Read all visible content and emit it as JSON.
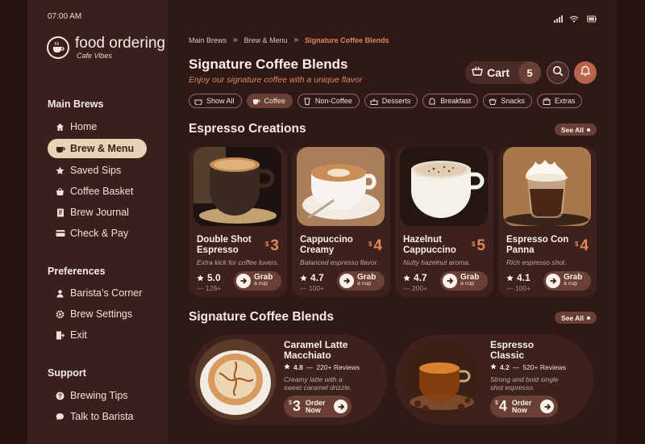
{
  "status": {
    "time": "07:00 AM"
  },
  "brand": {
    "title": "food ordering",
    "subtitle": "Cafe Vibes"
  },
  "sidebar": {
    "sections": [
      {
        "heading": "Main Brews",
        "items": [
          {
            "label": "Home",
            "icon": "home-icon"
          },
          {
            "label": "Brew & Menu",
            "icon": "coffee-cup-icon",
            "active": true
          },
          {
            "label": "Saved Sips",
            "icon": "star-icon"
          },
          {
            "label": "Coffee Basket",
            "icon": "basket-icon"
          },
          {
            "label": "Brew Journal",
            "icon": "journal-icon"
          },
          {
            "label": "Check & Pay",
            "icon": "card-icon"
          }
        ]
      },
      {
        "heading": "Preferences",
        "items": [
          {
            "label": "Barista’s Corner",
            "icon": "user-icon"
          },
          {
            "label": "Brew Settings",
            "icon": "gear-icon"
          },
          {
            "label": "Exit",
            "icon": "exit-icon"
          }
        ]
      },
      {
        "heading": "Support",
        "items": [
          {
            "label": "Brewing Tips",
            "icon": "help-icon"
          },
          {
            "label": "Talk to Barista",
            "icon": "chat-icon"
          }
        ]
      }
    ]
  },
  "breadcrumb": {
    "items": [
      "Main Brews",
      "Brew & Menu",
      "Signature Coffee Blends"
    ],
    "separator": "»"
  },
  "header": {
    "title": "Signature Coffee Blends",
    "subtitle": "Enjoy our signature coffee with a unique flavor",
    "cart_label": "Cart",
    "cart_count": "5"
  },
  "filters": [
    {
      "label": "Show All",
      "icon": "grid-icon"
    },
    {
      "label": "Coffee",
      "icon": "coffee-cup-icon",
      "active": true
    },
    {
      "label": "Non-Coffee",
      "icon": "cup-icon"
    },
    {
      "label": "Desserts",
      "icon": "cake-icon"
    },
    {
      "label": "Breakfast",
      "icon": "toast-icon"
    },
    {
      "label": "Snacks",
      "icon": "snack-icon"
    },
    {
      "label": "Extras",
      "icon": "extras-icon"
    }
  ],
  "espresso": {
    "title": "Espresso Creations",
    "see_all": "See All",
    "items": [
      {
        "name": "Double Shot Espresso",
        "currency": "$",
        "price": "3",
        "desc": "Extra kick for coffee lovers.",
        "rating": "5.0",
        "reviews": "128+",
        "grab": "Grab",
        "grab_sub": "a cup"
      },
      {
        "name": "Cappuccino Creamy",
        "currency": "$",
        "price": "4",
        "desc": "Balanced espresso flavor.",
        "rating": "4.7",
        "reviews": "100+",
        "grab": "Grab",
        "grab_sub": "a cup"
      },
      {
        "name": "Hazelnut Cappuccino",
        "currency": "$",
        "price": "5",
        "desc": "Nutty hazelnut aroma.",
        "rating": "4.7",
        "reviews": "200+",
        "grab": "Grab",
        "grab_sub": "a cup"
      },
      {
        "name": "Espresso Con Panna",
        "currency": "$",
        "price": "4",
        "desc": "Rich espresso shot.",
        "rating": "4.1",
        "reviews": "100+",
        "grab": "Grab",
        "grab_sub": "a cup"
      }
    ]
  },
  "blends": {
    "title": "Signature Coffee Blends",
    "see_all": "See All",
    "items": [
      {
        "name": "Caramel Latte Macchiato",
        "rating": "4.8",
        "reviews": "220+ Reviews",
        "desc": "Creamy latte with a sweet caramel drizzle.",
        "currency": "$",
        "price": "3",
        "order": "Order Now"
      },
      {
        "name": "Espresso Classic",
        "rating": "4.2",
        "reviews": "520+ Reviews",
        "desc": "Strong and bold single shot espresso.",
        "currency": "$",
        "price": "4",
        "order": "Order Now"
      }
    ]
  },
  "colors": {
    "accent": "#e0875a",
    "background": "#2f1917",
    "sidebar": "#3a201c",
    "active_nav": "#e9d3b6",
    "button": "#6a3f36"
  }
}
